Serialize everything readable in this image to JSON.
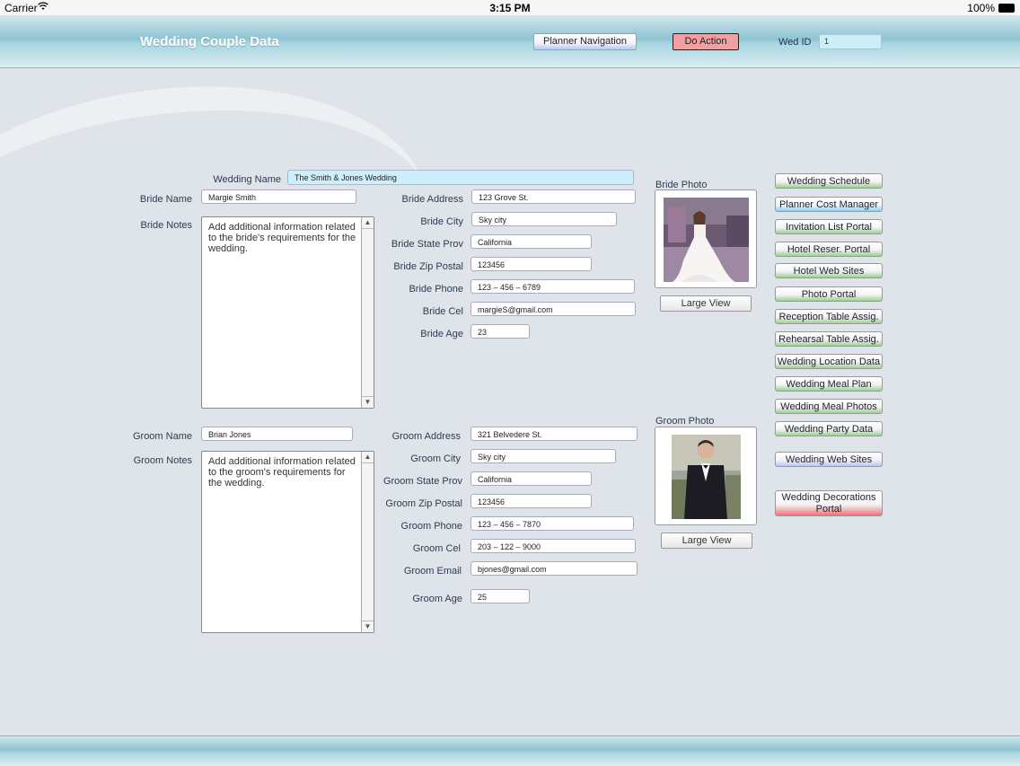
{
  "status_bar": {
    "carrier": "Carrier",
    "time": "3:15 PM",
    "battery": "100%"
  },
  "header": {
    "title": "Wedding Couple Data",
    "planner_nav_label": "Planner Navigation",
    "do_action_label": "Do Action",
    "wed_id_label": "Wed ID",
    "wed_id_value": "1"
  },
  "wedding": {
    "name_label": "Wedding Name",
    "name_value": "The Smith & Jones Wedding"
  },
  "bride": {
    "name_label": "Bride Name",
    "name_value": "Margie Smith",
    "notes_label": "Bride Notes",
    "notes_value": "Add additional information related to the bride's requirements for the wedding.",
    "address_label": "Bride Address",
    "address_value": "123 Grove St.",
    "city_label": "Bride City",
    "city_value": "Sky city",
    "state_label": "Bride State  Prov",
    "state_value": "California",
    "zip_label": "Bride Zip Postal",
    "zip_value": "123456",
    "phone_label": "Bride Phone",
    "phone_value": "123 – 456 – 6789",
    "cel_label": "Bride Cel",
    "cel_value": "margieS@gmail.com",
    "age_label": "Bride Age",
    "age_value": "23",
    "photo_label": "Bride Photo",
    "large_view_label": "Large View"
  },
  "groom": {
    "name_label": "Groom Name",
    "name_value": "Brian Jones",
    "notes_label": "Groom Notes",
    "notes_value": "Add additional information related to the groom's requirements for the wedding.",
    "address_label": "Groom Address",
    "address_value": " 321 Belvedere St.",
    "city_label": "Groom City",
    "city_value": "Sky city",
    "state_label": "Groom State  Prov",
    "state_value": "California",
    "zip_label": "Groom Zip  Postal",
    "zip_value": "123456",
    "phone_label": "Groom Phone",
    "phone_value": "123 – 456 – 7870",
    "cel_label": "Groom Cel",
    "cel_value": "203 – 122 – 9000",
    "email_label": "Groom Email",
    "email_value": "bjones@gmail.com",
    "age_label": "Groom Age",
    "age_value": "25",
    "photo_label": "Groom Photo",
    "large_view_label": "Large View"
  },
  "sidebar": {
    "buttons": [
      {
        "label": "Wedding Schedule",
        "style": "green"
      },
      {
        "label": "Planner Cost Manager",
        "style": "blue"
      },
      {
        "label": "Invitation List Portal",
        "style": "green"
      },
      {
        "label": "Hotel Reser. Portal",
        "style": "green"
      },
      {
        "label": "Hotel Web Sites",
        "style": "green"
      },
      {
        "label": "Photo Portal",
        "style": "green"
      },
      {
        "label": "Reception Table Assig.",
        "style": "green"
      },
      {
        "label": "Rehearsal Table Assig.",
        "style": "green"
      },
      {
        "label": "Wedding Location Data",
        "style": "green"
      },
      {
        "label": "Wedding Meal Plan",
        "style": "green"
      },
      {
        "label": "Wedding Meal Photos",
        "style": "green"
      },
      {
        "label": "Wedding Party Data",
        "style": "green"
      },
      {
        "label": "Wedding Web Sites",
        "style": "lavender"
      },
      {
        "label": "Wedding Decorations Portal",
        "style": "red"
      }
    ]
  },
  "icons": {
    "wifi": "wifi-icon",
    "battery": "battery-icon",
    "scroll_up": "scroll-up-arrow-icon",
    "scroll_down": "scroll-down-arrow-icon"
  }
}
